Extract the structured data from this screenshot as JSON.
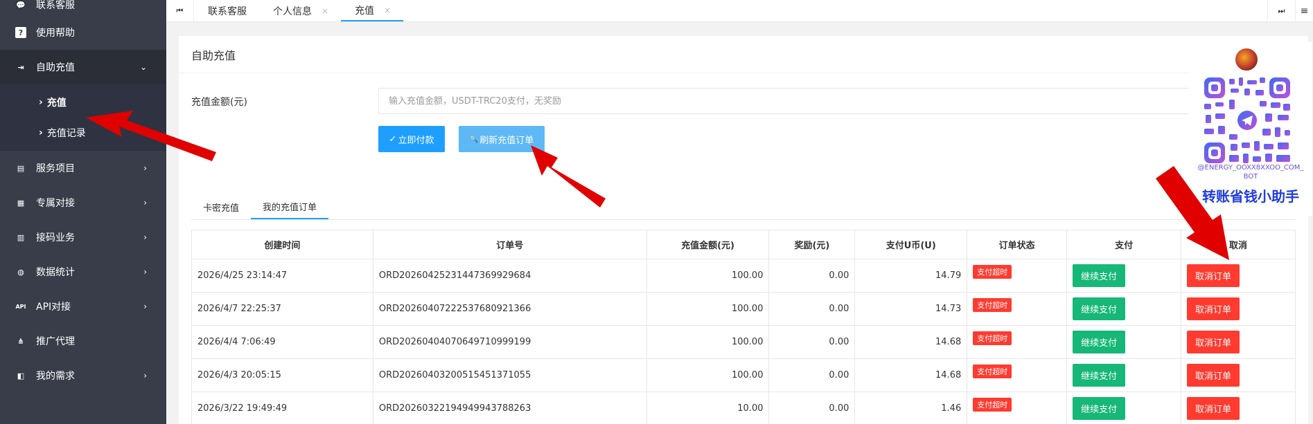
{
  "sidebar": {
    "items": [
      {
        "icon": "chat-icon",
        "glyph": "💬",
        "label": "联系客服"
      },
      {
        "icon": "help-icon",
        "glyph": "?",
        "label": "使用帮助"
      },
      {
        "icon": "recharge-icon",
        "glyph": "⇥",
        "label": "自助充值",
        "chevron": "⌄"
      },
      {
        "icon": "services-icon",
        "glyph": "▤",
        "label": "服务项目",
        "chevron": "›"
      },
      {
        "icon": "dock-icon",
        "glyph": "▦",
        "label": "专属对接",
        "chevron": "›"
      },
      {
        "icon": "code-icon",
        "glyph": "▥",
        "label": "接码业务",
        "chevron": "›"
      },
      {
        "icon": "stats-icon",
        "glyph": "◍",
        "label": "数据统计",
        "chevron": "›"
      },
      {
        "icon": "api-icon",
        "glyph": "API",
        "label": "API对接",
        "chevron": "›"
      },
      {
        "icon": "agent-icon",
        "glyph": "⋔",
        "label": "推广代理"
      },
      {
        "icon": "needs-icon",
        "glyph": "◧",
        "label": "我的需求",
        "chevron": "›"
      }
    ],
    "sub_items": [
      {
        "label": "充值",
        "bullet": "›"
      },
      {
        "label": "充值记录",
        "bullet": "›"
      }
    ]
  },
  "tabbar": {
    "first_glyph": "⏮",
    "last_glyph": "⏭",
    "menu_glyph": "≡",
    "close_glyph": "×",
    "tabs": [
      {
        "label": "联系客服",
        "closable": false
      },
      {
        "label": "个人信息",
        "closable": true
      },
      {
        "label": "充值",
        "closable": true,
        "active": true
      }
    ]
  },
  "card": {
    "title": "自助充值",
    "amount_label": "充值金额(元)",
    "amount_placeholder": "输入充值金额，USDT-TRC20支付，无奖励",
    "pay_button": "立即付款",
    "pay_glyph": "✓",
    "refresh_button": "刷新充值订单",
    "refresh_glyph": "🔍",
    "subtabs": [
      "卡密充值",
      "我的充值订单"
    ],
    "active_subtab": 1
  },
  "orders": {
    "headers": [
      "创建时间",
      "订单号",
      "充值金额(元)",
      "奖励(元)",
      "支付U币(U)",
      "订单状态",
      "支付",
      "取消"
    ],
    "rows": [
      {
        "time": "2026/4/25 23:14:47",
        "order_no": "ORD20260425231447369929684",
        "amount": "100.00",
        "reward": "0.00",
        "usdt": "14.79",
        "status": "支付超时",
        "pay": "继续支付",
        "cancel": "取消订单"
      },
      {
        "time": "2026/4/7 22:25:37",
        "order_no": "ORD20260407222537680921366",
        "amount": "100.00",
        "reward": "0.00",
        "usdt": "14.73",
        "status": "支付超时",
        "pay": "继续支付",
        "cancel": "取消订单"
      },
      {
        "time": "2026/4/4 7:06:49",
        "order_no": "ORD20260404070649710999199",
        "amount": "100.00",
        "reward": "0.00",
        "usdt": "14.68",
        "status": "支付超时",
        "pay": "继续支付",
        "cancel": "取消订单"
      },
      {
        "time": "2026/4/3 20:05:15",
        "order_no": "ORD20260403200515451371055",
        "amount": "100.00",
        "reward": "0.00",
        "usdt": "14.68",
        "status": "支付超时",
        "pay": "继续支付",
        "cancel": "取消订单"
      },
      {
        "time": "2026/3/22 19:49:49",
        "order_no": "ORD20260322194949943788263",
        "amount": "10.00",
        "reward": "0.00",
        "usdt": "1.46",
        "status": "支付超时",
        "pay": "继续支付",
        "cancel": "取消订单"
      }
    ]
  },
  "qr_overlay": {
    "handle": "@ENERGY_OOXX8XXOO_COM_BOT",
    "title": "转账省钱小助手"
  },
  "colors": {
    "sidebar_bg": "#393d49",
    "primary": "#1e9fff",
    "success": "#16b777",
    "danger": "#ff3b30",
    "amount_green": "#1b8f1b",
    "arrow_red": "#e00000"
  }
}
